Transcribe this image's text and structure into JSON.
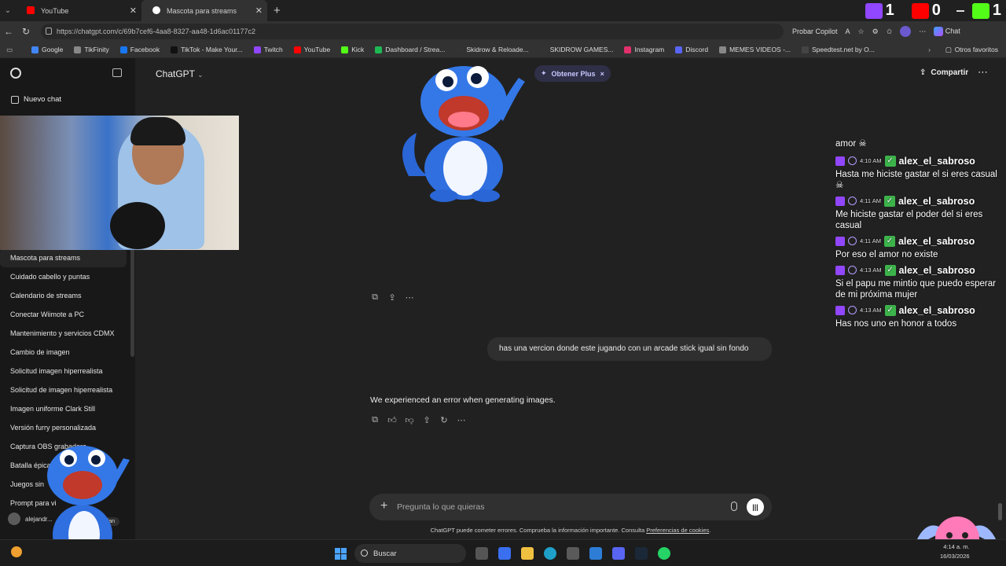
{
  "browser": {
    "tabs": [
      {
        "label": "YouTube",
        "color": "#ff0000"
      },
      {
        "label": "Mascota para streams",
        "color": "#ffffff"
      }
    ],
    "url": "https://chatgpt.com/c/69b7cef6-4aa8-8327-aa48-1d6ac01177c2",
    "copilot_label": "Probar Copilot",
    "chat_label": "Chat",
    "bookmarks": [
      {
        "label": "Google",
        "color": "#4285f4"
      },
      {
        "label": "TikFinity",
        "color": "#888888"
      },
      {
        "label": "Facebook",
        "color": "#1877f2"
      },
      {
        "label": "TikTok - Make Your...",
        "color": "#111111"
      },
      {
        "label": "Twitch",
        "color": "#9146ff"
      },
      {
        "label": "YouTube",
        "color": "#ff0000"
      },
      {
        "label": "Kick",
        "color": "#53fc18"
      },
      {
        "label": "Dashboard / Strea...",
        "color": "#1db954"
      },
      {
        "label": "Skidrow & Reloade...",
        "color": "#333333"
      },
      {
        "label": "SKIDROW GAMES...",
        "color": "#333333"
      },
      {
        "label": "Instagram",
        "color": "#e1306c"
      },
      {
        "label": "Discord",
        "color": "#5865f2"
      },
      {
        "label": "MEMES VIDEOS -...",
        "color": "#888888"
      },
      {
        "label": "Speedtest.net by O...",
        "color": "#444444"
      }
    ],
    "other_favorites": "Otros favoritos"
  },
  "stream_scores": {
    "twitch": "1",
    "youtube": "0",
    "kick": "1"
  },
  "sidebar": {
    "new_chat": "Nuevo chat",
    "history": [
      "Mascota para streams",
      "Cuidado cabello y puntas",
      "Calendario de streams",
      "Conectar Wiimote a PC",
      "Mantenimiento y servicios CDMX",
      "Cambio de imagen",
      "Solicitud imagen hiperrealista",
      "Solicitud de imagen hiperrealista",
      "Imagen uniforme Clark Still",
      "Versión furry personalizada",
      "Captura OBS grabadora",
      "Batalla épica",
      "Juegos sin",
      "Prompt para vi"
    ],
    "user_name": "alejandr...",
    "plan": "Plan"
  },
  "main": {
    "title": "ChatGPT",
    "obtener_plus": "Obtener Plus",
    "share": "Compartir",
    "user_message": "has una vercion donde este jugando con un arcade stick igual sin fondo",
    "assistant_message": "We experienced an error when generating images.",
    "composer_placeholder": "Pregunta lo que quieras",
    "disclaimer": "ChatGPT puede cometer errores. Comprueba la información importante. Consulta",
    "disclaimer_link": "Preferencias de cookies",
    "disclaimer_end": "."
  },
  "stream_chat": {
    "first_line": "amor",
    "messages": [
      {
        "time": "4:10 AM",
        "user": "alex_el_sabroso",
        "text": "Hasta me hiciste gastar el si eres casual"
      },
      {
        "time": "4:11 AM",
        "user": "alex_el_sabroso",
        "text": "Me hiciste gastar el poder del si eres casual"
      },
      {
        "time": "4:11 AM",
        "user": "alex_el_sabroso",
        "text": "Por eso el amor no existe"
      },
      {
        "time": "4:13 AM",
        "user": "alex_el_sabroso",
        "text": "Si el papu me mintio que puedo esperar de mi próxima mujer"
      },
      {
        "time": "4:13 AM",
        "user": "alex_el_sabroso",
        "text": "Has nos uno en honor a todos"
      }
    ]
  },
  "taskbar": {
    "search": "Buscar",
    "time": "4:14 a. m.",
    "date": "16/03/2026"
  }
}
